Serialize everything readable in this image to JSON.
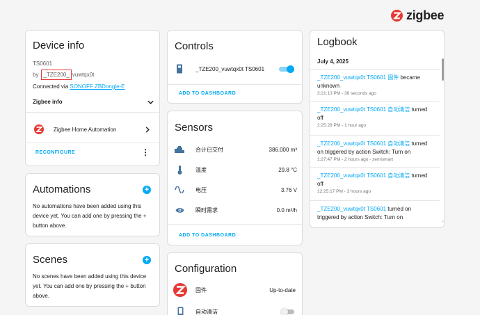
{
  "brand": {
    "name": "zigbee",
    "color": "#e53935"
  },
  "accent_color": "#03a9f4",
  "device_info": {
    "title": "Device info",
    "model": "TS0601",
    "by_prefix": "by",
    "manufacturer_highlight": "_TZE200_",
    "manufacturer_rest": "vuwtqx0t",
    "connected_prefix": "Connected via",
    "connected_link": "SONOFF ZBDongle-E",
    "zigbee_info_label": "Zigbee info",
    "integration_label": "Zigbee Home Automation",
    "reconfigure_label": "RECONFIGURE"
  },
  "automations": {
    "title": "Automations",
    "empty_text": "No automations have been added using this device yet. You can add one by pressing the + button above."
  },
  "scenes": {
    "title": "Scenes",
    "empty_text": "No scenes have been added using this device yet. You can add one by pressing the + button above."
  },
  "controls": {
    "title": "Controls",
    "items": [
      {
        "label": "_TZE200_vuwtqx0t TS0601",
        "state": "on",
        "icon": "remote-icon"
      }
    ],
    "add_to_dashboard": "ADD TO DASHBOARD"
  },
  "sensors": {
    "title": "Sensors",
    "items": [
      {
        "label": "合计已交付",
        "value": "386.000 m³",
        "icon": "water-pump-icon"
      },
      {
        "label": "温度",
        "value": "29.8 °C",
        "icon": "thermometer-icon"
      },
      {
        "label": "电压",
        "value": "3.76 V",
        "icon": "sine-wave-icon"
      },
      {
        "label": "瞬时需求",
        "value": "0.0 m³/h",
        "icon": "eye-icon"
      }
    ],
    "add_to_dashboard": "ADD TO DASHBOARD"
  },
  "configuration": {
    "title": "Configuration",
    "items": [
      {
        "label": "固件",
        "value": "Up-to-date",
        "icon": "zigbee-icon"
      },
      {
        "label": "自动清洁",
        "state": "off",
        "icon": "phone-icon"
      }
    ]
  },
  "logbook": {
    "title": "Logbook",
    "date": "July 4, 2025",
    "entries": [
      {
        "entity": "_TZE200_vuwtqx0t TS0601 固件",
        "message": " became unknown",
        "time": "3:21:13 PM - 36 seconds ago"
      },
      {
        "entity": "_TZE200_vuwtqx0t TS0601 自动清洁",
        "message": " turned off",
        "time": "2:25:28 PM - 1 hour ago"
      },
      {
        "entity": "_TZE200_vuwtqx0t TS0601 自动清洁",
        "message": " turned on triggered by action Switch: Turn on",
        "time": "1:27:47 PM - 2 hours ago - zemismart"
      },
      {
        "entity": "_TZE200_vuwtqx0t TS0601 自动清洁",
        "message": " turned off",
        "time": "12:25:17 PM - 3 hours ago"
      },
      {
        "entity": "_TZE200_vuwtqx0t TS0601",
        "message": " turned on triggered by action Switch: Turn on",
        "time": ""
      }
    ]
  }
}
